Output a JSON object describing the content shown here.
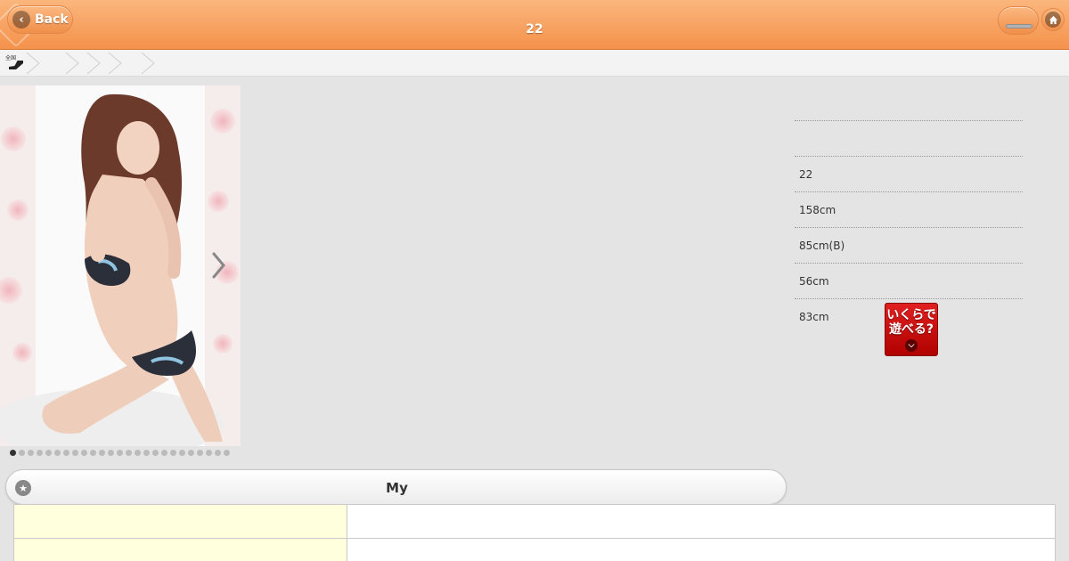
{
  "header": {
    "back_label": "Back",
    "title": "22"
  },
  "profile": {
    "rows": [
      {
        "value": ""
      },
      {
        "value": "22"
      },
      {
        "value": "158cm"
      },
      {
        "value": "85cm(B)"
      },
      {
        "value": "56cm"
      },
      {
        "value": "83cm"
      }
    ]
  },
  "price_badge": {
    "line1": "いくらで",
    "line2": "遊べる?"
  },
  "breadcrumb": {
    "logo_text": "全国"
  },
  "photo": {
    "slide_count": 25,
    "active_index": 0
  },
  "my_bar": {
    "label": "My"
  },
  "colors": {
    "header_orange": "#f4924b",
    "badge_red": "#d01010",
    "table_header_yellow": "#ffffdd"
  },
  "icons": {
    "back": "chevron-left-icon",
    "home": "home-icon",
    "menu": "menu-icon",
    "star": "star-icon",
    "next": "chevron-right-icon"
  }
}
